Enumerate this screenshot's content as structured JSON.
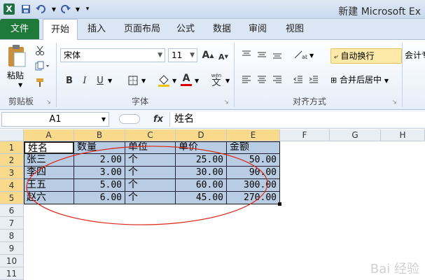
{
  "window": {
    "title": "新建 Microsoft Ex"
  },
  "quick_access": {
    "items": [
      "excel-logo",
      "save-icon",
      "undo-icon",
      "redo-icon",
      "customize-icon"
    ],
    "logo_text": "X"
  },
  "tabs": [
    {
      "label": "文件"
    },
    {
      "label": "开始"
    },
    {
      "label": "插入"
    },
    {
      "label": "页面布局"
    },
    {
      "label": "公式"
    },
    {
      "label": "数据"
    },
    {
      "label": "审阅"
    },
    {
      "label": "视图"
    }
  ],
  "ribbon": {
    "clipboard": {
      "paste_label": "粘贴",
      "group_label": "剪贴板"
    },
    "font": {
      "name": "宋体",
      "size": "11",
      "group_label": "字体",
      "bold": "B",
      "italic": "I",
      "underline": "U",
      "grow": "A",
      "shrink": "A",
      "color_glyph": "A",
      "phonetic": "wén"
    },
    "alignment": {
      "wrap_text": "自动换行",
      "merge_center": "合并后居中",
      "group_label": "对齐方式"
    },
    "number": {
      "format": "会计专"
    }
  },
  "formula_bar": {
    "name_box": "A1",
    "fx": "fx",
    "content": "姓名"
  },
  "sheet": {
    "columns": [
      "A",
      "B",
      "C",
      "D",
      "E",
      "F",
      "G",
      "H"
    ],
    "rows": [
      "1",
      "2",
      "3",
      "4",
      "5",
      "6",
      "7",
      "8",
      "9",
      "10",
      "11"
    ],
    "cells": [
      [
        "姓名",
        "数量",
        "单位",
        "单价",
        "金额"
      ],
      [
        "张三",
        "2.00",
        "个",
        "25.00",
        "50.00"
      ],
      [
        "李四",
        "3.00",
        "个",
        "30.00",
        "90.00"
      ],
      [
        "王五",
        "5.00",
        "个",
        "60.00",
        "300.00"
      ],
      [
        "赵六",
        "6.00",
        "个",
        "45.00",
        "270.00"
      ]
    ]
  },
  "watermark": "Bai 经验"
}
